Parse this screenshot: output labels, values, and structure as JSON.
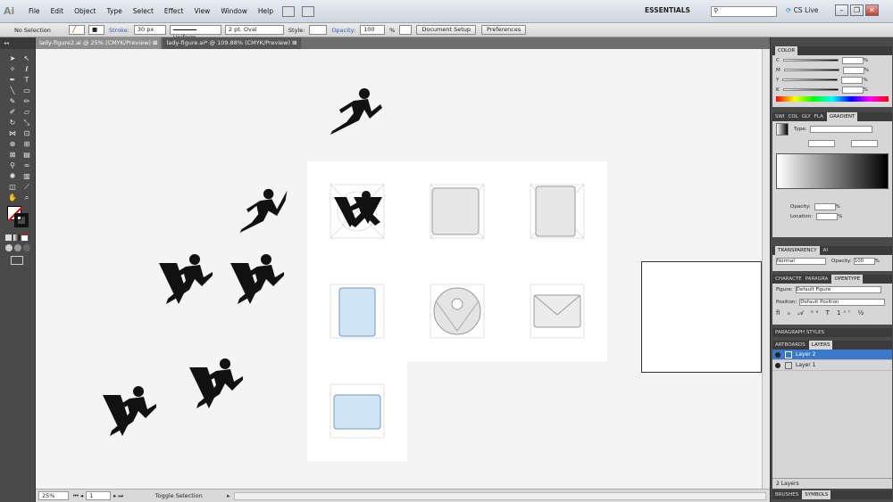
{
  "menubar": {
    "logo": "Ai",
    "items": [
      "File",
      "Edit",
      "Object",
      "Type",
      "Select",
      "Effect",
      "View",
      "Window",
      "Help"
    ],
    "workspace": "ESSENTIALS",
    "cslive": "CS Live"
  },
  "controlbar": {
    "selection": "No Selection",
    "stroke_label": "Stroke:",
    "stroke_value": "30 px",
    "profile": "Uniform",
    "brush": "2 pt. Oval",
    "style_label": "Style:",
    "opacity_label": "Opacity:",
    "opacity_value": "100",
    "opacity_unit": "%",
    "doc_setup": "Document Setup",
    "preferences": "Preferences"
  },
  "tabs": [
    {
      "label": "lady-figure2.ai @ 25% (CMYK/Preview)",
      "close": "⊠"
    },
    {
      "label": "lady-figure.ai* @ 109.88% (CMYK/Preview)",
      "close": "⊠"
    }
  ],
  "status": {
    "zoom": "25%",
    "page": "1",
    "info": "Toggle Selection"
  },
  "panels": {
    "color": {
      "title": "COLOR",
      "channels": [
        "C",
        "M",
        "Y",
        "K"
      ],
      "unit": "%"
    },
    "gradient": {
      "tabs": [
        "SWI",
        "COL",
        "GLY",
        "FLA",
        "GRADIENT"
      ],
      "type_label": "Type:",
      "opacity_label": "Opacity:",
      "location_label": "Location:",
      "unit": "%"
    },
    "transparency": {
      "tabs": [
        "TRANSPARENCY",
        "AI"
      ],
      "mode": "Normal",
      "opacity_label": "Opacity:",
      "opacity_value": "100",
      "unit": "%"
    },
    "opentype": {
      "tabs": [
        "CHARACTE",
        "PARAGRA",
        "OPENTYPE"
      ],
      "figure_label": "Figure:",
      "figure_value": "Default Figure",
      "position_label": "Position:",
      "position_value": "Default Position"
    },
    "paragraph_styles": {
      "title": "PARAGRAPH STYLES"
    },
    "layers": {
      "tabs": [
        "ARTBOARDS",
        "LAYERS"
      ],
      "items": [
        "Layer 2",
        "Layer 1"
      ],
      "count": "2 Layers"
    },
    "bottom_tabs": [
      "BRUSHES",
      "SYMBOLS"
    ]
  }
}
